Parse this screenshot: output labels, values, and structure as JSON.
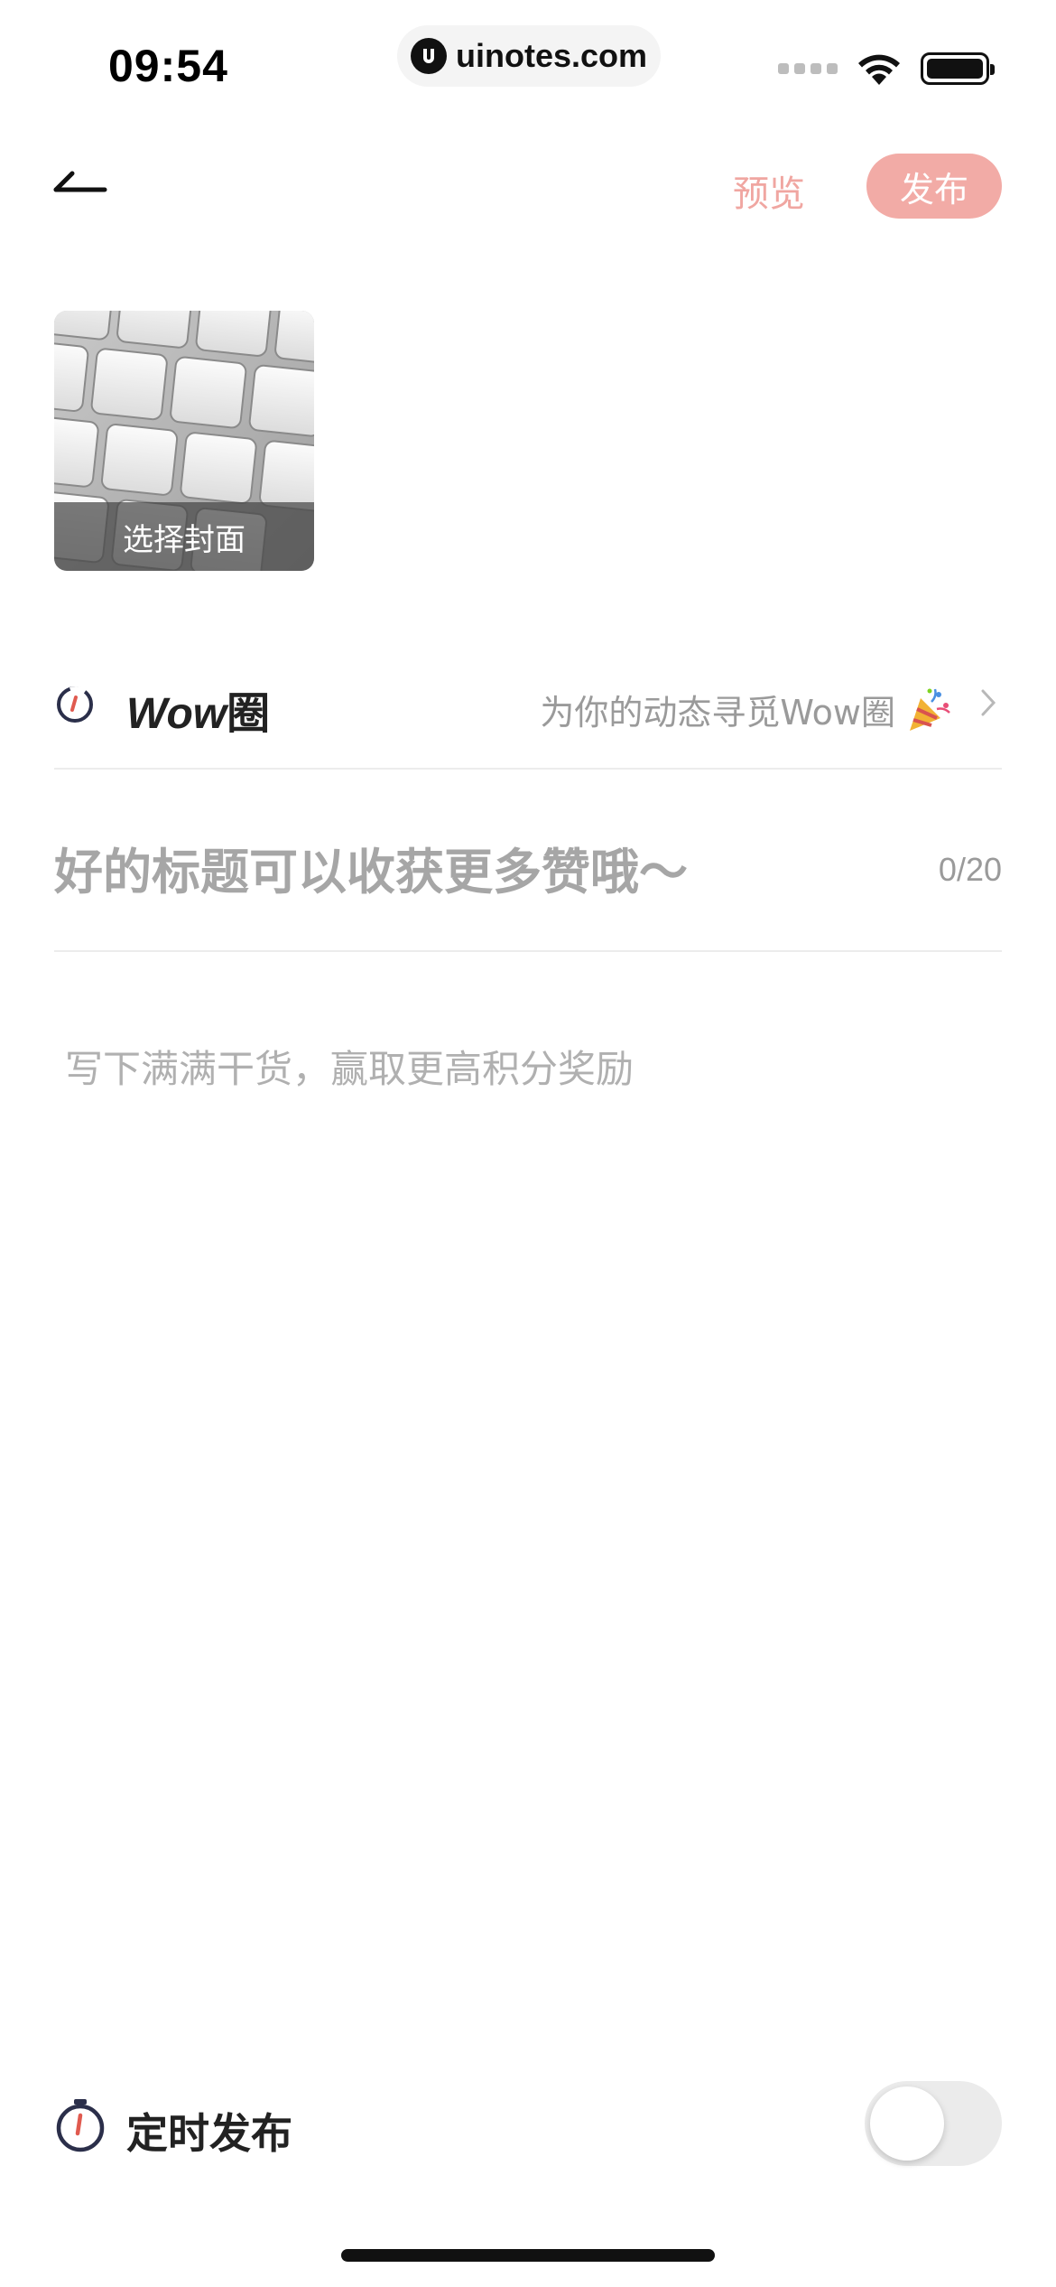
{
  "status_bar": {
    "time": "09:54",
    "url": "uinotes.com",
    "icons": [
      "signal-icon",
      "wifi-icon",
      "battery-icon"
    ]
  },
  "nav": {
    "back_icon": "back-arrow-icon",
    "preview_label": "预览",
    "publish_label": "发布"
  },
  "cover": {
    "caption": "选择封面"
  },
  "wow": {
    "title_en": "Wow",
    "title_cn": "圈",
    "hint": "为你的动态寻觅Wow圈",
    "icon": "wow-circle-icon",
    "emoji_icon": "party-popper-icon"
  },
  "title_field": {
    "value": "",
    "placeholder": "好的标题可以收获更多赞哦～",
    "count": "0/20"
  },
  "body_field": {
    "value": "",
    "placeholder": "写下满满干货，赢取更高积分奖励"
  },
  "schedule": {
    "label": "定时发布",
    "enabled": false
  },
  "colors": {
    "accent": "#f2aba6",
    "accent_text": "#f0a6a1",
    "placeholder": "#a6a6a6",
    "divider": "#ececec",
    "toggle_off": "#ebebeb"
  }
}
